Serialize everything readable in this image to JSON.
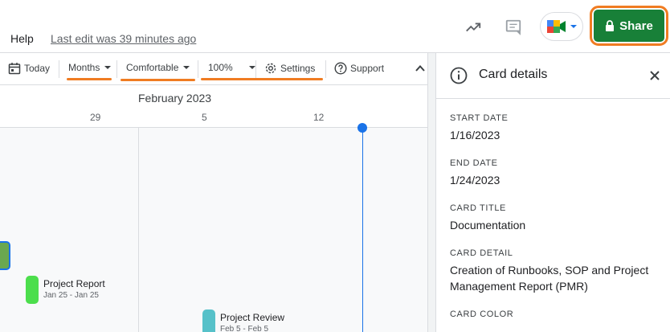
{
  "topbar": {
    "help_label": "Help",
    "last_edit": "Last edit was 39 minutes ago",
    "share_label": "Share",
    "accent_color": "#188038",
    "highlight_color": "#f07c22"
  },
  "toolbar": {
    "today_label": "Today",
    "months_label": "Months",
    "density_label": "Comfortable",
    "zoom_label": "100%",
    "settings_label": "Settings",
    "support_label": "Support"
  },
  "timeline": {
    "month": "February 2023",
    "days": [
      "29",
      "5",
      "12"
    ],
    "cards": [
      {
        "title": "Project Report",
        "range": "Jan 25 - Jan 25",
        "color": "#4cde4c"
      },
      {
        "title": "Project Review",
        "range": "Feb 5 - Feb 5",
        "color": "#56c1c9"
      }
    ],
    "selected_card_color": "#6aa84f",
    "today_color": "#1a73e8"
  },
  "panel": {
    "title": "Card details",
    "fields": [
      {
        "label": "START DATE",
        "value": "1/16/2023"
      },
      {
        "label": "END DATE",
        "value": "1/24/2023"
      },
      {
        "label": "CARD TITLE",
        "value": "Documentation"
      },
      {
        "label": "CARD DETAIL",
        "value": "Creation of Runbooks, SOP and Project Management Report (PMR)"
      },
      {
        "label": "CARD COLOR",
        "value": ""
      }
    ]
  }
}
